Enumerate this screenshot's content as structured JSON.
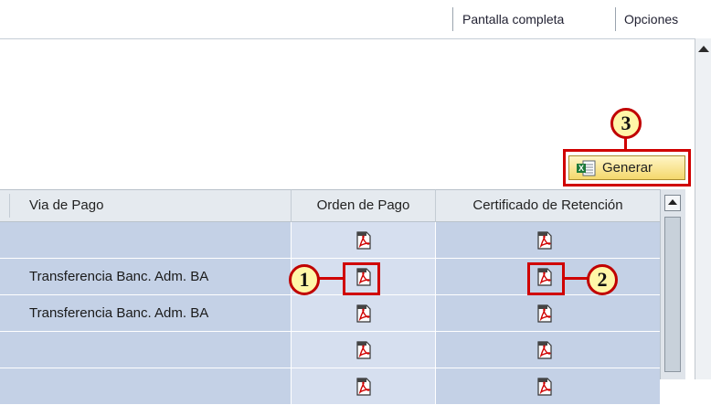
{
  "toolbar": {
    "fullscreen_label": "Pantalla completa",
    "options_label": "Opciones"
  },
  "generate_button": {
    "label": "Generar",
    "icon": "excel-export-icon"
  },
  "callouts": [
    "1",
    "2",
    "3"
  ],
  "table": {
    "headers": [
      "Via de Pago",
      "Orden de Pago",
      "Certificado de Retención"
    ],
    "rows": [
      {
        "via_pago": "",
        "orden_icon": "pdf-icon",
        "cert_icon": "pdf-icon"
      },
      {
        "via_pago": "Transferencia Banc. Adm. BA",
        "orden_icon": "pdf-icon",
        "cert_icon": "pdf-icon"
      },
      {
        "via_pago": "Transferencia Banc. Adm. BA",
        "orden_icon": "pdf-icon",
        "cert_icon": "pdf-icon"
      },
      {
        "via_pago": "",
        "orden_icon": "pdf-icon",
        "cert_icon": "pdf-icon"
      },
      {
        "via_pago": "",
        "orden_icon": "pdf-icon",
        "cert_icon": "pdf-icon"
      }
    ]
  },
  "colors": {
    "highlight": "#d00000",
    "callout_fill": "#fff6a8",
    "row_dark": "#c4d1e6",
    "row_light": "#d6dfef"
  }
}
